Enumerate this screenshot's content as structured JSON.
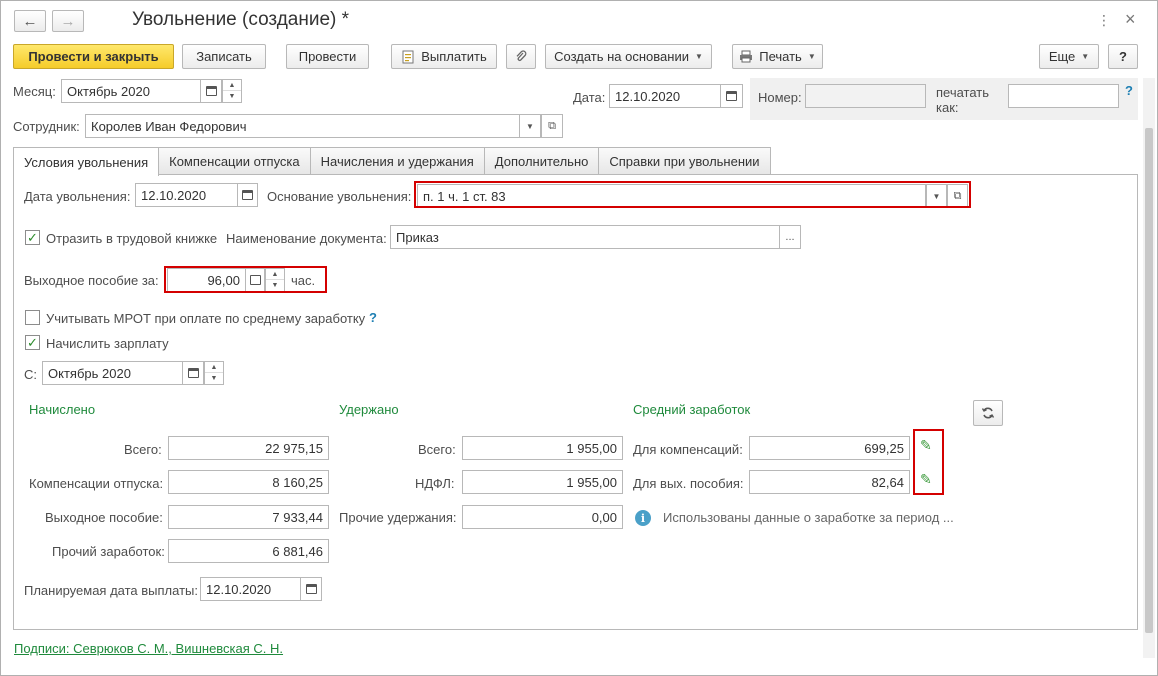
{
  "window": {
    "title": "Увольнение (создание) *",
    "back_icon": "←",
    "forward_icon": "→",
    "menu_icon": "⋮",
    "close_icon": "×"
  },
  "toolbar": {
    "post_close": "Провести и закрыть",
    "save": "Записать",
    "post": "Провести",
    "pay": "Выплатить",
    "create_based": "Создать на основании",
    "print": "Печать",
    "more": "Еще",
    "help": "?"
  },
  "header": {
    "month_label": "Месяц:",
    "month_value": "Октябрь 2020",
    "date_label": "Дата:",
    "date_value": "12.10.2020",
    "number_label": "Номер:",
    "number_value": "",
    "print_as_label_1": "печатать",
    "print_as_label_2": "как:",
    "print_as_value": "",
    "help": "?",
    "employee_label": "Сотрудник:",
    "employee_value": "Королев Иван Федорович"
  },
  "tabs": [
    "Условия увольнения",
    "Компенсации отпуска",
    "Начисления и удержания",
    "Дополнительно",
    "Справки при увольнении"
  ],
  "conditions": {
    "dismissal_date_label": "Дата увольнения:",
    "dismissal_date_value": "12.10.2020",
    "basis_label": "Основание увольнения:",
    "basis_value": "п. 1 ч. 1 ст. 83",
    "workbook_label": "Отразить в трудовой книжке",
    "doc_name_label": "Наименование документа:",
    "doc_name_value": "Приказ",
    "severance_label": "Выходное пособие за:",
    "severance_value": "96,00",
    "severance_unit": "час.",
    "mrot_label": "Учитывать МРОТ при оплате по среднему заработку",
    "mrot_help": "?",
    "accrue_salary_label": "Начислить зарплату",
    "from_label": "С:",
    "from_value": "Октябрь 2020",
    "more_btn": "..."
  },
  "accrued": {
    "header": "Начислено",
    "total_label": "Всего:",
    "total_value": "22 975,15",
    "vacation_comp_label": "Компенсации отпуска:",
    "vacation_comp_value": "8 160,25",
    "severance_label": "Выходное пособие:",
    "severance_value": "7 933,44",
    "other_label": "Прочий заработок:",
    "other_value": "6 881,46"
  },
  "withheld": {
    "header": "Удержано",
    "total_label": "Всего:",
    "total_value": "1 955,00",
    "ndfl_label": "НДФЛ:",
    "ndfl_value": "1 955,00",
    "other_label": "Прочие удержания:",
    "other_value": "0,00"
  },
  "average": {
    "header": "Средний заработок",
    "comp_label": "Для компенсаций:",
    "comp_value": "699,25",
    "severance_label": "Для вых. пособия:",
    "severance_value": "82,64",
    "info_text": "Использованы данные о заработке за период ...",
    "info_icon": "i"
  },
  "payment": {
    "planned_date_label": "Планируемая дата выплаты:",
    "planned_date_value": "12.10.2020"
  },
  "footer": {
    "signatures_link": "Подписи: Севрюков С. М., Вишневская С. Н."
  },
  "colors": {
    "accent_green": "#1f8a3c",
    "primary_button": "#f5cc2a",
    "highlight_red": "#d40000"
  }
}
